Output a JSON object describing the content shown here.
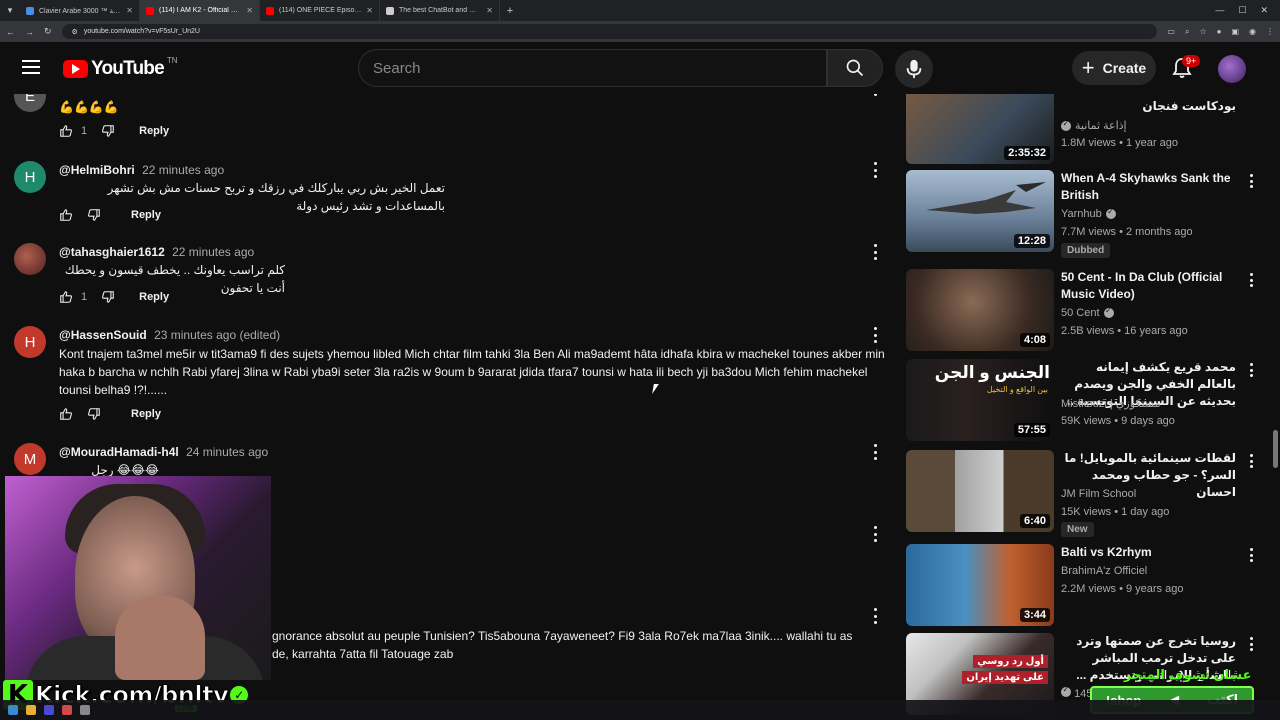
{
  "browser": {
    "tabs": [
      {
        "title": "Clavier Arabe 3000 ™ لوحة المفاتيح العربية",
        "color": "#4a90e2"
      },
      {
        "title": "(114) I AM K2 - Official Movie | ...",
        "color": "#ff0000"
      },
      {
        "title": "(114) ONE PIECE Episode 1070 ...",
        "color": "#ff0000"
      },
      {
        "title": "The best ChatBot and Widgets ...",
        "color": "#cccccc"
      }
    ],
    "url": "youtube.com/watch?v=vF5sUr_Un2U"
  },
  "header": {
    "logo_text": "YouTube",
    "region": "TN",
    "search_placeholder": "Search",
    "create_label": "Create",
    "notif_count": "9+"
  },
  "comments": [
    {
      "initial": "E",
      "avatar_color": "#555555",
      "author": "",
      "time": "",
      "text": "💪💪💪💪",
      "likes": "1",
      "reply": "Reply",
      "rtl": false
    },
    {
      "initial": "H",
      "avatar_color": "#1e8a6a",
      "author": "@HelmiBohri",
      "time": "22 minutes ago",
      "text": "تعمل الخير بش ربي يباركلك في رزقك و تربح حسنات مش بش تشهر بالمساعدات و تشد رئيس دولة",
      "likes": "",
      "reply": "Reply",
      "rtl": true
    },
    {
      "initial": "",
      "avatar_color": "#8a4a3a",
      "author": "@tahasghaier1612",
      "time": "22 minutes ago",
      "text": "كلم تراسب يعاونك .. يخطف قيسون و يحطك أنت يا تحفون",
      "likes": "1",
      "reply": "Reply",
      "rtl": true
    },
    {
      "initial": "H",
      "avatar_color": "#c0392b",
      "author": "@HassenSouid",
      "time": "23 minutes ago (edited)",
      "text": "Kont tnajem ta3mel me5ir w tit3ama9 fi des sujets yhemou libled Mich chtar film tahki 3la Ben Ali ma9ademt hâta idhafa kbira w machekel tounes akber min haka b barcha w nchlh Rabi yfarej 3lina w Rabi yba9i seter 3la ra2is w 9oum b 9ararat jdida tfara7 tounsi w hata ili bech yji ba3dou Mich fehim machekel tounsi belha9 !?!......",
      "likes": "",
      "reply": "Reply",
      "rtl": false
    },
    {
      "initial": "M",
      "avatar_color": "#c0392b",
      "author": "@MouradHamadi-h4l",
      "time": "24 minutes ago",
      "text": "😂😂😂 رجل اعمال",
      "likes": "",
      "reply": "",
      "rtl": true
    },
    {
      "initial": "",
      "avatar_color": "#0f0f0f",
      "author": "",
      "time": "",
      "text": "gnorance  absolut au peuple Tunisien?  Tis5abouna  7ayaweneet?  Fi9 3ala Ro7ek  ma7laa 3inik.... wallahi tu as",
      "text2": "de,  karrahta 7atta  fil  Tatouage zab",
      "likes": "",
      "reply": "",
      "rtl": false
    }
  ],
  "recommendations": [
    {
      "title": "بودكاست فنجان",
      "channel": "إذاعة ثمانية",
      "verified": true,
      "meta": "1.8M views • 1 year ago",
      "duration": "2:35:32",
      "chip": "",
      "rtl": true,
      "thumb_colors": [
        "#7a5a40",
        "#3a4a5a"
      ]
    },
    {
      "title": "When A-4 Skyhawks Sank the British",
      "channel": "Yarnhub",
      "verified": true,
      "meta": "7.7M views • 2 months ago",
      "duration": "12:28",
      "chip": "Dubbed",
      "rtl": false,
      "thumb_colors": [
        "#8aa0b8",
        "#4a5a6a"
      ]
    },
    {
      "title": "50 Cent - In Da Club (Official Music Video)",
      "channel": "50 Cent",
      "verified": true,
      "meta": "2.5B views • 16 years ago",
      "duration": "4:08",
      "chip": "",
      "rtl": false,
      "thumb_colors": [
        "#6a5040",
        "#2a2a2a"
      ]
    },
    {
      "title": "محمد قريع يكشف إيمانه بالعالم الخفي والجن ويصدم بحديثه عن السينما التونسية ..",
      "channel": "Mistkouzi | مستكوزي",
      "verified": false,
      "meta": "59K views • 9 days ago",
      "duration": "57:55",
      "chip": "",
      "rtl": true,
      "thumb_colors": [
        "#1a1a1a",
        "#5a3a2a"
      ]
    },
    {
      "title": "لقطات سينمائية بالموبايل! ما السر؟ - جو حطاب ومحمد احسان",
      "channel": "JM Film School",
      "verified": false,
      "meta": "15K views • 1 day ago",
      "duration": "6:40",
      "chip": "New",
      "rtl": true,
      "thumb_colors": [
        "#5a4a3a",
        "#9a9a9a"
      ]
    },
    {
      "title": "Balti vs K2rhym",
      "channel": "BrahimA'z Officiel",
      "verified": false,
      "meta": "2.2M views • 9 years ago",
      "duration": "3:44",
      "chip": "",
      "rtl": false,
      "thumb_colors": [
        "#2a6a9a",
        "#c06030"
      ]
    },
    {
      "title": "روسيا تخرج عن صمتها وترد على تدخل ترمب المباشر بالشأن الإيراني وتستخدم ...",
      "channel": "",
      "verified": true,
      "meta": "145K",
      "duration": "",
      "chip": "",
      "rtl": true,
      "thumb_colors": [
        "#b0202a",
        "#3a2a2a"
      ]
    }
  ],
  "stream_overlay": {
    "kick_text": "Kick.com/bnltv",
    "live_label": "LIVE",
    "shop_label": "!shop",
    "shop_arabic": "اكتب",
    "store_arabic": "عشان تشوف المتجر"
  },
  "thumb_overlays": {
    "rec4_big": "الجنس و الجن",
    "rec4_small": "بين الواقع و التخيل",
    "rec7_a": "أول رد روسي",
    "rec7_b": "على تهديد إيران"
  }
}
